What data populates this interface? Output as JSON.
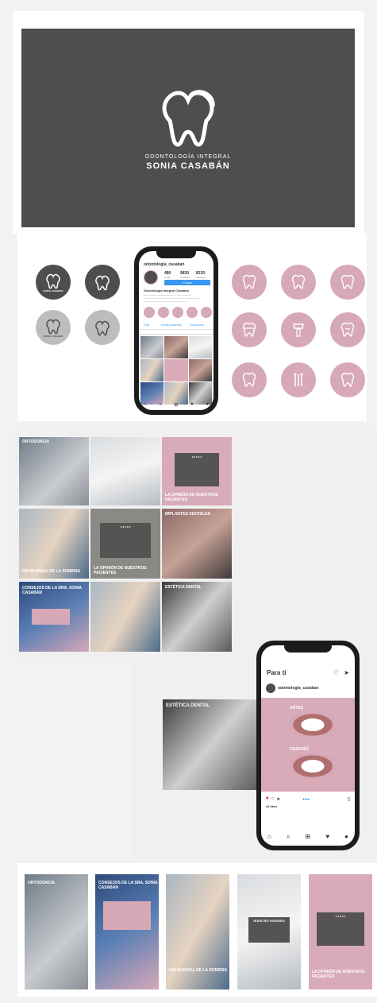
{
  "brand": {
    "logo_subtitle": "ODONTOLOGÍA INTEGRAL",
    "logo_name": "SONIA CASABÁN",
    "accent": "#d7a8b6",
    "dark": "#4f4e4c"
  },
  "mini_logo": {
    "line1": "ODONTOLOGÍA INTEGRAL",
    "line2": "SONIA CASABÁN"
  },
  "profile": {
    "username": "odontologia_casaban",
    "posts": "480",
    "followers": "9830",
    "following": "8230",
    "posts_label": "posts",
    "followers_label": "followers",
    "following_label": "following",
    "follow_button": "Follow",
    "display_name": "Odontología Integral Casabán",
    "call": "Call",
    "email": "Email Address",
    "directions": "Directions"
  },
  "grid_tiles": {
    "t1": "ORTODONCIA",
    "t3": "LA OPINIÓN DE NUESTROS PACIENTES",
    "t4": "DÍA MUNDIAL DE LA SONRISA",
    "t5": "LA OPINIÓN DE NUESTROS PACIENTES",
    "t6": "IMPLANTES DENTALES",
    "t7": "CONSEJOS DE LA DRA. SONIA CASABÁN",
    "t9": "ESTÉTICA DENTAL"
  },
  "feed": {
    "para_ti": "Para ti",
    "username": "odontologia_casaban",
    "antes": "ANTES",
    "despues": "DESPUÉS",
    "likes": "44 likes",
    "side_label": "ESTÉTICA DENTAL"
  },
  "stories": {
    "s1": "ORTODONCIA",
    "s2": "CONSEJOS DE LA SRA. SONIA CASABÁN",
    "s3": "DÍA MUNDIAL DE LA SONRISA",
    "s4": "NUESTRO HORARIO",
    "s5": "LA OPINIÓN DE NUESTROS PACIENTES"
  },
  "icons": [
    "tooth-logo-icon",
    "tooth-icon",
    "implant-icon",
    "braces-icon",
    "smile-tooth-icon",
    "tools-icon",
    "heart-icon",
    "search-icon",
    "home-icon",
    "send-icon",
    "comment-icon",
    "bookmark-icon"
  ]
}
